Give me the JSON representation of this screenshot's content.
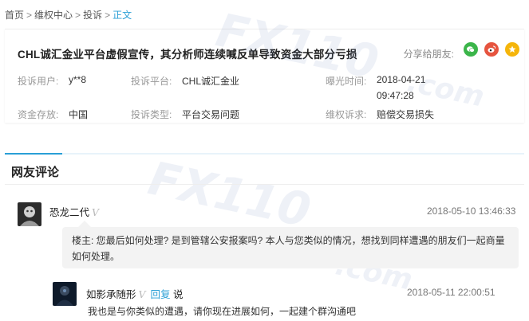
{
  "breadcrumb": {
    "items": [
      "首页",
      "维权中心",
      "投诉"
    ],
    "separator": ">",
    "current": "正文"
  },
  "complaint": {
    "title": "CHL诚汇金业平台虚假宣传，其分析师连续喊反单导致资金大部分亏损",
    "share_label": "分享给朋友:",
    "share_icons": [
      "wechat-icon",
      "weibo-icon",
      "qzone-icon"
    ],
    "fields": {
      "user": {
        "label": "投诉用户:",
        "value": "y**8"
      },
      "platform": {
        "label": "投诉平台:",
        "value": "CHL诚汇金业"
      },
      "exposure_time": {
        "label": "曝光时间:",
        "value_date": "2018-04-21",
        "value_time": "09:47:28"
      },
      "deposit": {
        "label": "资金存放:",
        "value": "中国"
      },
      "type": {
        "label": "投诉类型:",
        "value": "平台交易问题"
      },
      "claim": {
        "label": "维权诉求:",
        "value": "赔偿交易损失"
      }
    }
  },
  "watermark": {
    "text": "FX110",
    "suffix": ".com"
  },
  "comments_section": {
    "title": "网友评论",
    "comments": [
      {
        "user": "恐龙二代",
        "badge": "V",
        "time": "2018-05-10 13:46:33",
        "text": "楼主: 您最后如何处理? 是到管辖公安报案吗? 本人与您类似的情况，想找到同样遭遇的朋友们一起商量如何处理。"
      }
    ],
    "replies": [
      {
        "user": "如影承随形",
        "badge": "V",
        "reply_label": "回复",
        "say_label": "说",
        "time": "2018-05-11 22:00:51",
        "text": "我也是与你类似的遭遇，请你现在进展如何，一起建个群沟通吧"
      }
    ]
  },
  "colors": {
    "accent": "#2a9fd6",
    "wechat": "#3bb54a",
    "weibo": "#e6543f",
    "qzone": "#f5b50a"
  }
}
